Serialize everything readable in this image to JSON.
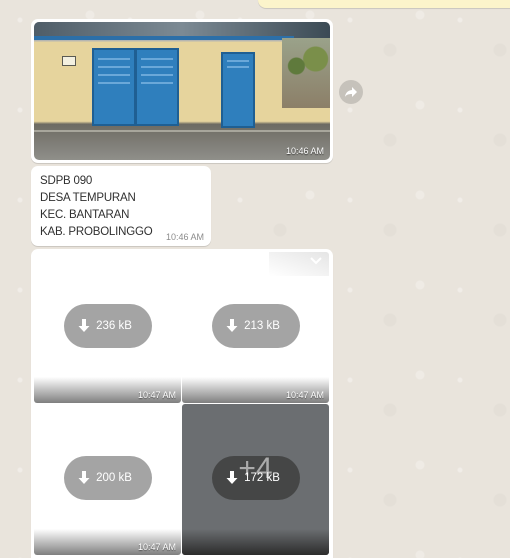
{
  "messages": {
    "photo": {
      "time": "10:46 AM"
    },
    "text": {
      "lines": [
        "SDPB 090",
        "DESA TEMPURAN",
        "KEC. BANTARAN",
        "KAB. PROBOLINGGO"
      ],
      "time": "10:46 AM"
    },
    "album": {
      "tiles": [
        {
          "size": "236 kB",
          "time": "10:47 AM"
        },
        {
          "size": "213 kB",
          "time": "10:47 AM"
        },
        {
          "size": "200 kB",
          "time": "10:47 AM"
        },
        {
          "size": "172 kB",
          "more": "+4"
        }
      ]
    }
  },
  "icons": {
    "forward": "forward-icon",
    "download": "download-arrow-icon",
    "menu": "chevron-down-icon"
  },
  "colors": {
    "chat_background": "#e9e4dc",
    "bubble": "#ffffff",
    "outgoing_bubble": "#fcf4cb",
    "download_pill": "#a4a4a4"
  }
}
